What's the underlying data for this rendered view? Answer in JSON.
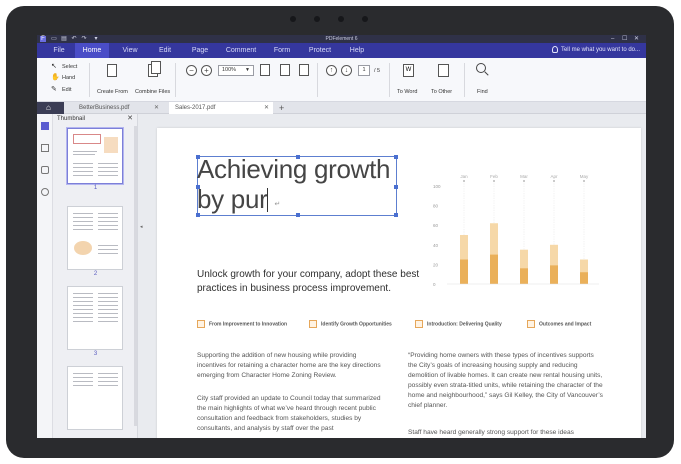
{
  "app": {
    "title": "PDFelement 6",
    "window_controls": [
      "–",
      "☐",
      "✕"
    ],
    "quick_access": [
      "save-icon",
      "print-icon",
      "undo-icon",
      "redo-icon",
      "customize-icon"
    ]
  },
  "menu": {
    "items": [
      {
        "label": "File",
        "active": false
      },
      {
        "label": "Home",
        "active": true
      },
      {
        "label": "View",
        "active": false
      },
      {
        "label": "Edit",
        "active": false
      },
      {
        "label": "Page",
        "active": false
      },
      {
        "label": "Comment",
        "active": false
      },
      {
        "label": "Form",
        "active": false
      },
      {
        "label": "Protect",
        "active": false
      },
      {
        "label": "Help",
        "active": false
      }
    ],
    "tell_me": "Tell me what you want to do..."
  },
  "ribbon": {
    "select": "Select",
    "hand": "Hand",
    "edit": "Edit",
    "create_from": "Create From",
    "combine_files": "Combine Files",
    "zoom_out": "−",
    "zoom_in": "+",
    "zoom_value": "100%",
    "page_current": "1",
    "page_total": "/ 5",
    "to_word": "To Word",
    "to_other": "To Other",
    "find": "Find"
  },
  "tabs": [
    {
      "label": "BetterBusiness.pdf",
      "active": false
    },
    {
      "label": "Sales-2017.pdf",
      "active": true
    }
  ],
  "sidebar": {
    "title": "Thumbnail",
    "pages": [
      "1",
      "2",
      "3"
    ]
  },
  "document": {
    "headline_line1": "Achieving growth",
    "headline_line2": "by pur",
    "subhead": "Unlock growth for your company, adopt these best practices in business process improvement.",
    "features": [
      "From Improvement to Innovation",
      "Identify Growth Opportunities",
      "Introduction: Delivering Quality",
      "Outcomes and Impact"
    ],
    "col1_p1": "Supporting the addition of new housing while providing incentives for retaining a character home are the key directions emerging from Character Home Zoning Review.",
    "col1_p2": "City staff provided an update to Council today that summarized the main highlights of what we’ve heard through recent public consultation and feedback from stakeholders, studies by consultants, and analysis by staff over the past",
    "col2_p1": "“Providing home owners with these types of incentives supports the City’s goals of increasing housing supply and reducing demolition of livable homes. It can create new rental housing units, possibly even strata-titled units, while retaining the character of the home and neighbourhood,” says Gil Kelley, the City of Vancouver’s chief planner.",
    "col2_p2": "Staff have heard generally strong support for these ideas"
  },
  "chart_data": {
    "type": "bar",
    "categories": [
      "Jan",
      "Feb",
      "Mar",
      "Apr",
      "May"
    ],
    "series": [
      {
        "values": [
          25,
          30,
          16,
          19,
          12
        ]
      },
      {
        "values": [
          50,
          62,
          35,
          40,
          25
        ]
      }
    ],
    "ylim": [
      0,
      100
    ],
    "yticks": [
      "100",
      "80",
      "60",
      "40",
      "20",
      "0"
    ],
    "colors": {
      "dark": "#eab05a",
      "light": "#f6d8a8",
      "guide": "#e6e6e6"
    }
  }
}
